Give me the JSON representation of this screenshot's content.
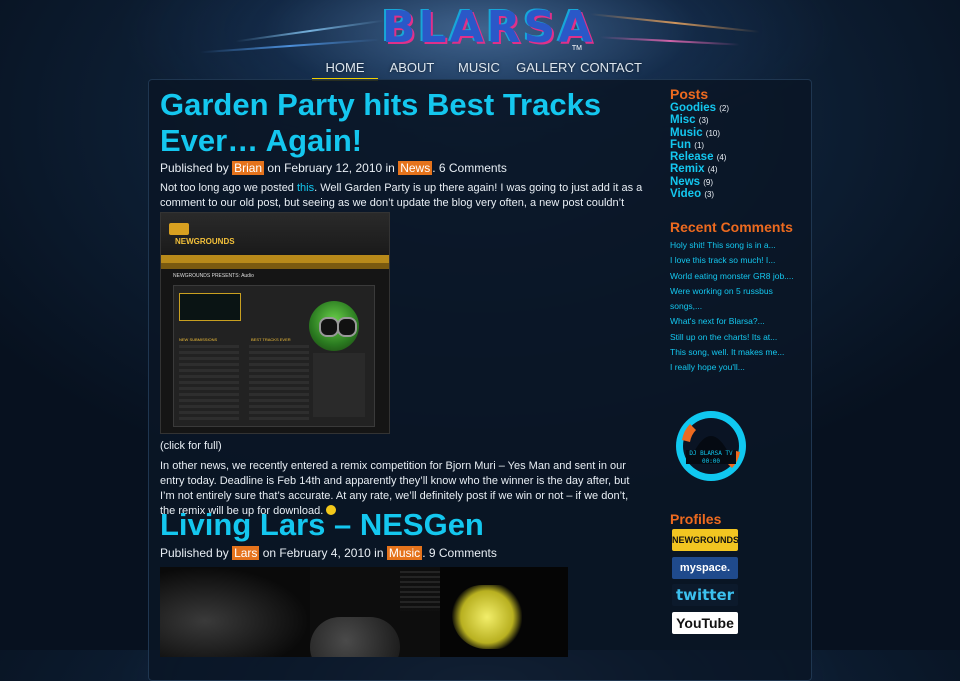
{
  "logo": {
    "text": "BLARSA",
    "tm": "TM"
  },
  "nav": [
    {
      "label": "HOME",
      "active": true
    },
    {
      "label": "ABOUT",
      "active": false
    },
    {
      "label": "MUSIC",
      "active": false
    },
    {
      "label": "GALLERY",
      "active": false
    },
    {
      "label": "CONTACT",
      "active": false
    }
  ],
  "posts": [
    {
      "title": "Garden Party hits Best Tracks Ever… Again!",
      "meta": {
        "prefix": "Published by",
        "author": "Brian",
        "date_text": "on February 12, 2010 in",
        "category": "News",
        "comments": ". 6 Comments"
      },
      "para1_before_link": "Not too long ago we posted ",
      "para1_link": "this",
      "para1_after_link": ". Well Garden Party is up there again! I was going to just add it as a comment to our old post, but seeing as we don’t update the blog very often, a new post couldn’t hurt!",
      "caption": "(click for full)",
      "para2": "In other news, we recently entered a remix competition for Bjorn Muri – Yes Man and sent in our entry today. Deadline is Feb 14th and apparently they’ll know who the winner is the day after, but I’m not entirely sure that’s accurate. At any rate, we’ll definitely post if we win or not – if we don’t, the remix will be up for download.",
      "screenshot_text": {
        "site_name": "NEWGROUNDS",
        "heading": "NEWGROUNDS PRESENTS: Audio",
        "side_label": "NEW SUBMISSIONS",
        "best_label": "BEST TRACKS EVER"
      }
    },
    {
      "title": "Living Lars – NESGen",
      "meta": {
        "prefix": "Published by",
        "author": "Lars",
        "date_text": "on February 4, 2010 in",
        "category": "Music",
        "comments": ". 9 Comments"
      }
    }
  ],
  "sidebar": {
    "posts_heading": "Posts",
    "categories": [
      {
        "name": "Goodies",
        "count": "(2)"
      },
      {
        "name": "Misc",
        "count": "(3)"
      },
      {
        "name": "Music",
        "count": "(10)"
      },
      {
        "name": "Fun",
        "count": "(1)"
      },
      {
        "name": "Release",
        "count": "(4)"
      },
      {
        "name": "Remix",
        "count": "(4)"
      },
      {
        "name": "News",
        "count": "(9)"
      },
      {
        "name": "Video",
        "count": "(3)"
      }
    ],
    "recent_heading": "Recent Comments",
    "recent_comments": [
      "Holy shit! This song is in a...",
      "I love this track so much! I...",
      "World eating monster GR8 job....",
      "Were working on 5 russbus",
      "songs,...",
      "What's next for Blarsa?...",
      "Still up on the charts! Its at...",
      "This song, well. It makes me...",
      "I really hope you'll..."
    ],
    "badge": {
      "line1": "DJ BLARSA TV",
      "line2": "00:00"
    },
    "profiles_heading": "Profiles",
    "profiles": [
      {
        "label": "NEWGROUNDS",
        "bg": "#f2c521",
        "fg": "#111111"
      },
      {
        "label": "myspace.",
        "bg": "#1f4a8c",
        "fg": "#ffffff"
      },
      {
        "label": "twitter",
        "bg": "#0c1a2c",
        "fg": "#3cc0ee"
      },
      {
        "label": "YouTube",
        "bg": "#ffffff",
        "fg": "#111111"
      }
    ]
  },
  "colors": {
    "accent": "#14c7ef",
    "orange": "#e5731c",
    "nav_active": "#f0d000"
  }
}
